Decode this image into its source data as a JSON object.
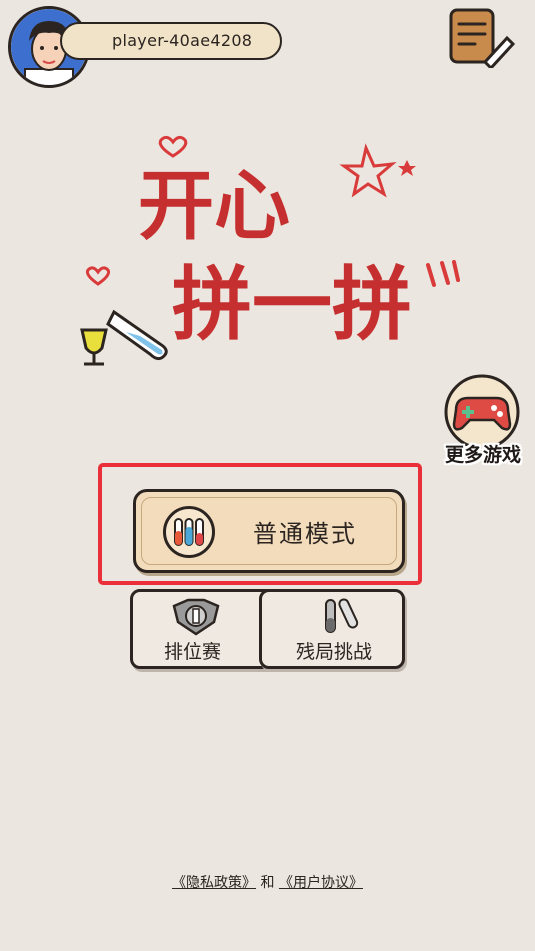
{
  "player": {
    "name": "player-40ae4208"
  },
  "title": {
    "line1": "开心",
    "line2": "拼一拼"
  },
  "side": {
    "more_games_label": "更多游戏"
  },
  "modes": {
    "normal_label": "普通模式",
    "ranked_label": "排位赛",
    "endgame_label": "残局挑战"
  },
  "footer": {
    "privacy_link": "《隐私政策》",
    "connector": "和",
    "terms_link": "《用户协议》"
  },
  "colors": {
    "background": "#ebe6df",
    "title_red": "#c62f2f",
    "highlight_red": "#e9303a",
    "button_tan": "#f3dcbc"
  }
}
